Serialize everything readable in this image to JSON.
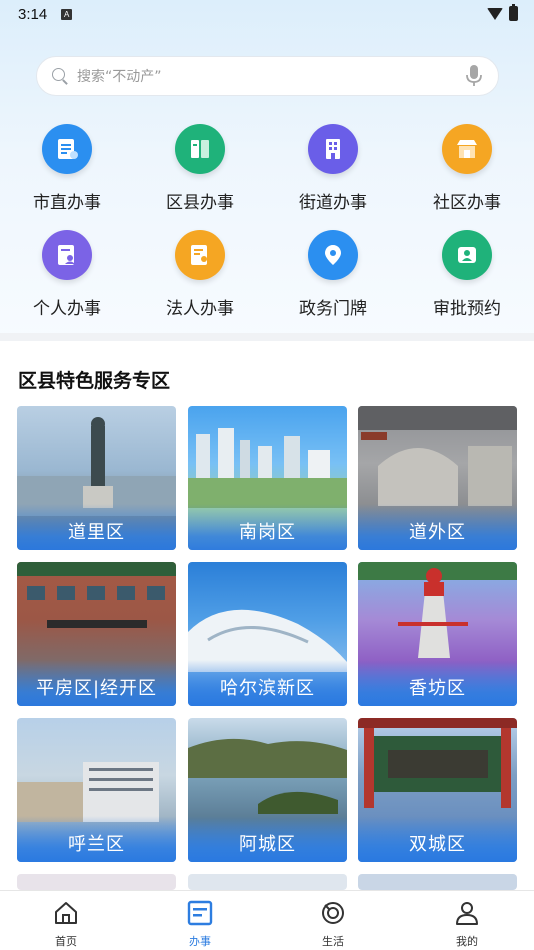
{
  "status": {
    "time": "3:14",
    "indicator": "A"
  },
  "search": {
    "placeholder": "搜索“不动产”"
  },
  "services": [
    {
      "label": "市直办事",
      "icon": "document-icon",
      "color": "#2b8ff0"
    },
    {
      "label": "区县办事",
      "icon": "book-icon",
      "color": "#1fb27a"
    },
    {
      "label": "街道办事",
      "icon": "building-icon",
      "color": "#6a5ee8"
    },
    {
      "label": "社区办事",
      "icon": "store-icon",
      "color": "#f5a623"
    },
    {
      "label": "个人办事",
      "icon": "person-file-icon",
      "color": "#7b63e6"
    },
    {
      "label": "法人办事",
      "icon": "legal-person-icon",
      "color": "#f5a623"
    },
    {
      "label": "政务门牌",
      "icon": "map-pin-icon",
      "color": "#2b8ff0"
    },
    {
      "label": "审批预约",
      "icon": "id-card-icon",
      "color": "#1fb27a"
    }
  ],
  "section": {
    "title": "区县特色服务专区"
  },
  "districts": [
    {
      "name": "道里区"
    },
    {
      "name": "南岗区"
    },
    {
      "name": "道外区"
    },
    {
      "name": "平房区|经开区"
    },
    {
      "name": "哈尔滨新区"
    },
    {
      "name": "香坊区"
    },
    {
      "name": "呼兰区"
    },
    {
      "name": "阿城区"
    },
    {
      "name": "双城区"
    }
  ],
  "nav": [
    {
      "label": "首页",
      "icon": "home-icon"
    },
    {
      "label": "办事",
      "icon": "service-icon",
      "active": true
    },
    {
      "label": "生活",
      "icon": "life-icon"
    },
    {
      "label": "我的",
      "icon": "profile-icon"
    }
  ],
  "colors": {
    "accent": "#2d7de0",
    "tile_label_bg": "#2d7de0"
  }
}
